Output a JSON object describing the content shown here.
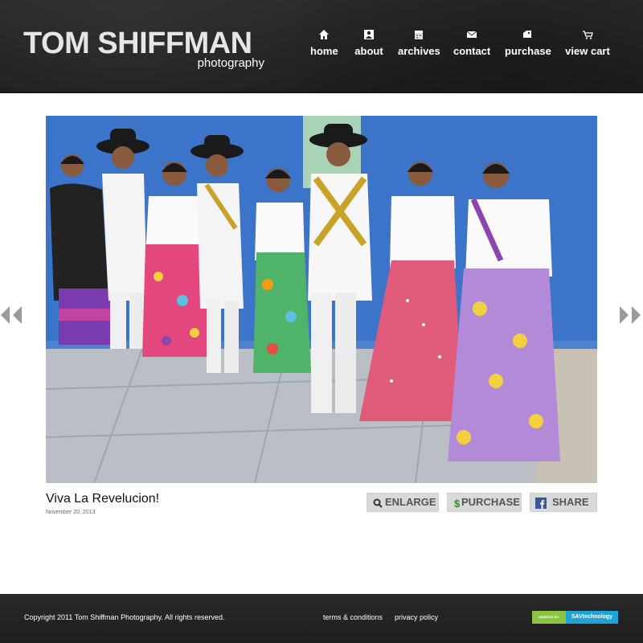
{
  "header": {
    "logo_name": "TOM SHIFFMAN",
    "logo_sub": "photography"
  },
  "nav": {
    "items": [
      {
        "label": "home",
        "icon": "home-icon"
      },
      {
        "label": "about",
        "icon": "person-icon"
      },
      {
        "label": "archives",
        "icon": "calendar-icon"
      },
      {
        "label": "contact",
        "icon": "envelope-icon"
      },
      {
        "label": "purchase",
        "icon": "tag-icon"
      },
      {
        "label": "view cart",
        "icon": "cart-icon"
      }
    ]
  },
  "photo": {
    "title": "Viva La Revelucion!",
    "date": "November 20, 2013"
  },
  "actions": {
    "enlarge": "ENLARGE",
    "purchase": "PURCHASE",
    "share": "SHARE"
  },
  "footer": {
    "copyright": "Copyright 2011 Tom Shiffman Photography. All rights reserved.",
    "terms": "terms & conditions",
    "privacy": "privacy policy",
    "badge_left": "WEBSITE BY:",
    "badge_right": "SAVtechnology"
  },
  "colors": {
    "header_bg": "#262626",
    "wall_blue": "#3a74c8",
    "button_bg": "#d9d9d9",
    "badge_green": "#8cc63f",
    "badge_blue": "#1fa3d8"
  }
}
